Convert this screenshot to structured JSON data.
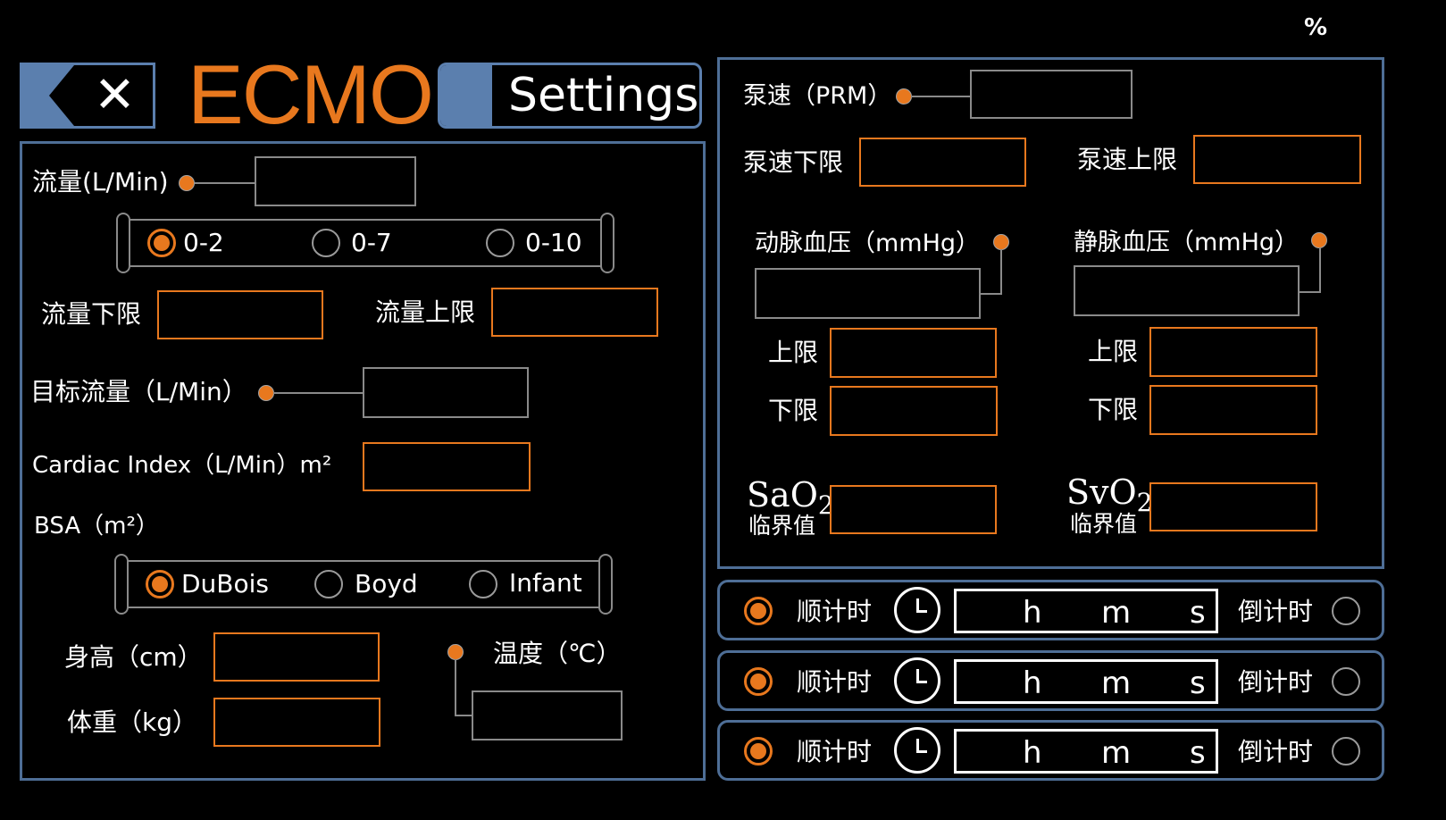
{
  "top_right": {
    "label": "%"
  },
  "header": {
    "title": "ECMO",
    "settings_label": "Settings",
    "close_glyph": "✕",
    "icons": {
      "back": "back-arrow-icon",
      "close": "close-icon"
    }
  },
  "colors": {
    "accent": "#e8781e",
    "panel_border": "#4e6e96",
    "box_gray": "#8a8a8a",
    "background": "#000000"
  },
  "left": {
    "flow_label": "流量(L/Min)",
    "flow_value": "",
    "flow_range": {
      "options": [
        "0-2",
        "0-7",
        "0-10"
      ],
      "selected": "0-2"
    },
    "flow_lower_label": "流量下限",
    "flow_lower_value": "",
    "flow_upper_label": "流量上限",
    "flow_upper_value": "",
    "target_flow_label": "目标流量（L/Min）",
    "target_flow_value": "",
    "cardiac_index_label": "Cardiac Index（L/Min）m²",
    "cardiac_index_value": "",
    "bsa_label": "BSA（m²）",
    "bsa_method": {
      "options": [
        "DuBois",
        "Boyd",
        "Infant"
      ],
      "selected": "DuBois"
    },
    "height_label": "身高（cm）",
    "height_value": "",
    "weight_label": "体重（kg）",
    "weight_value": "",
    "temp_label": "温度（℃）",
    "temp_value": ""
  },
  "right": {
    "pump_speed_label": "泵速（PRM）",
    "pump_speed_value": "",
    "pump_lower_label": "泵速下限",
    "pump_lower_value": "",
    "pump_upper_label": "泵速上限",
    "pump_upper_value": "",
    "arterial_label": "动脉血压（mmHg）",
    "arterial_value": "",
    "arterial_upper_label": "上限",
    "arterial_upper_value": "",
    "arterial_lower_label": "下限",
    "arterial_lower_value": "",
    "venous_label": "静脉血压（mmHg）",
    "venous_value": "",
    "venous_upper_label": "上限",
    "venous_upper_value": "",
    "venous_lower_label": "下限",
    "venous_lower_value": "",
    "sao2_main": "SaO",
    "sao2_sub": "2",
    "sao2_caption": "临界值",
    "sao2_value": "",
    "svo2_main": "SvO",
    "svo2_sub": "2",
    "svo2_caption": "临界值",
    "svo2_value": ""
  },
  "timers": [
    {
      "up_label": "顺计时",
      "down_label": "倒计时",
      "h": "h",
      "m": "m",
      "s": "s",
      "mode": "up"
    },
    {
      "up_label": "顺计时",
      "down_label": "倒计时",
      "h": "h",
      "m": "m",
      "s": "s",
      "mode": "up"
    },
    {
      "up_label": "顺计时",
      "down_label": "倒计时",
      "h": "h",
      "m": "m",
      "s": "s",
      "mode": "up"
    }
  ]
}
